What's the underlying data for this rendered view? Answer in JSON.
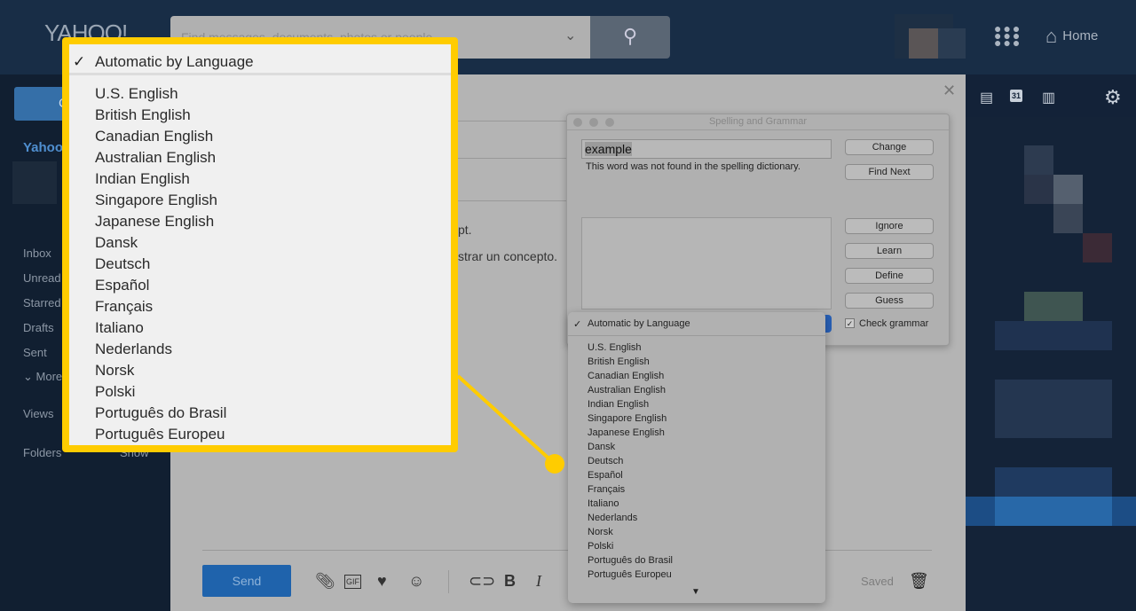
{
  "header": {
    "logo": "YAHOO!",
    "search_placeholder": "Find messages, documents, photos or people",
    "home_label": "Home"
  },
  "sidebar": {
    "compose_label": "C",
    "account_label": "Yahoo",
    "items": [
      "Inbox",
      "Unread",
      "Starred",
      "Drafts",
      "Sent",
      "More"
    ],
    "views_label": "Views",
    "folders_label": "Folders",
    "folders_action": "Show"
  },
  "compose": {
    "body_lines": [
      "pt.",
      "strar un concepto."
    ],
    "send_label": "Send",
    "saved_label": "Saved"
  },
  "spelling_dialog": {
    "title": "Spelling and Grammar",
    "word": "example",
    "message": "This word was not found in the spelling dictionary.",
    "buttons": [
      "Change",
      "Find Next",
      "Ignore",
      "Learn",
      "Define",
      "Guess"
    ],
    "check_grammar_label": "Check grammar",
    "check_grammar": true
  },
  "language_menu": {
    "selected": "Automatic by Language",
    "options": [
      "U.S. English",
      "British English",
      "Canadian English",
      "Australian English",
      "Indian English",
      "Singapore English",
      "Japanese English",
      "Dansk",
      "Deutsch",
      "Español",
      "Français",
      "Italiano",
      "Nederlands",
      "Norsk",
      "Polski",
      "Português do Brasil",
      "Português Europeu"
    ]
  },
  "colors": {
    "callout": "#ffcc00",
    "header": "#182d46",
    "send": "#1f63ac"
  }
}
